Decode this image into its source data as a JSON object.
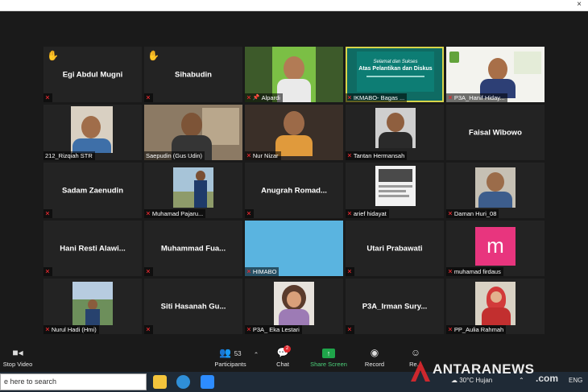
{
  "window": {
    "close_glyph": "×"
  },
  "tiles": [
    {
      "name": "Egi Abdul Mugni",
      "label": "",
      "hand": true
    },
    {
      "name": "Sihabudin",
      "label": "",
      "hand": true
    },
    {
      "name": "",
      "label": "Alpardi",
      "pinned": true
    },
    {
      "name": "",
      "label": "IKMABO- Bagas ...",
      "highlight": true,
      "slide_line1": "Selamat dan Sukses",
      "slide_line2": "Atas Pelantikan dan Diskus"
    },
    {
      "name": "",
      "label": "P3A_Hanif Hiday..."
    },
    {
      "name": "",
      "label": "212_Rizqiah STR"
    },
    {
      "name": "",
      "label": "Saepudin (Gus Udin)"
    },
    {
      "name": "",
      "label": "Nur Nizar"
    },
    {
      "name": "",
      "label": "Tantan Hermansah"
    },
    {
      "name": "Faisal Wibowo",
      "label": ""
    },
    {
      "name": "Sadam Zaenudin",
      "label": ""
    },
    {
      "name": "",
      "label": "Muhamad Pajaru..."
    },
    {
      "name": "Anugrah Romad...",
      "label": ""
    },
    {
      "name": "",
      "label": "arief hidayat"
    },
    {
      "name": "",
      "label": "Daman Huri_08"
    },
    {
      "name": "Hani Resti Alawi...",
      "label": ""
    },
    {
      "name": "Muhammad Fua...",
      "label": ""
    },
    {
      "name": "",
      "label": "HIMABO",
      "bg": "#5ab4e0"
    },
    {
      "name": "Utari Prabawati",
      "label": ""
    },
    {
      "name": "",
      "label": "muhamad firdaus",
      "avatar_letter": "m"
    },
    {
      "name": "",
      "label": "Nurul Hadi (Hmi)"
    },
    {
      "name": "Siti Hasanah Gu...",
      "label": ""
    },
    {
      "name": "",
      "label": "P3A_ Eka Lestari"
    },
    {
      "name": "P3A_Irman Sury...",
      "label": ""
    },
    {
      "name": "",
      "label": "PP_Aulia Rahmah"
    }
  ],
  "toolbar": {
    "stop_video": "Stop Video",
    "participants": "Participants",
    "participants_count": "53",
    "chat": "Chat",
    "chat_badge": "2",
    "share_screen": "Share Screen",
    "record": "Record",
    "reactions": "Re..."
  },
  "taskbar": {
    "search_text": "e here to search",
    "weather": "30°C  Hujan",
    "lang": "ENG"
  },
  "watermark": {
    "text": "ANTARANEWS",
    "suffix": ".com"
  },
  "colors": {
    "stage_bg": "#1a1a1a",
    "tile_bg": "#232323",
    "mic_muted": "#e0282e",
    "highlight": "#d8d54a",
    "share_green": "#1fa54a",
    "avatar_pink": "#e8357e"
  }
}
